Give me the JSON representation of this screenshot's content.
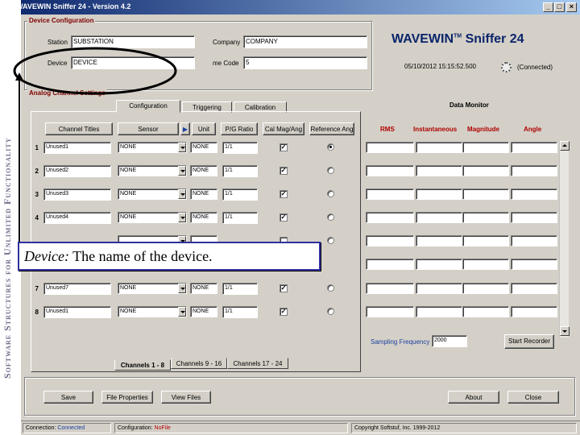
{
  "window": {
    "title": "WAVEWIN Sniffer 24 - Version 4.2",
    "minimize": "_",
    "maximize": "□",
    "close": "×"
  },
  "side_banner": "Software Structures for Unlimited Functionality",
  "device_config": {
    "group_label": "Device Configuration",
    "station_label": "Station",
    "station_value": "SUBSTATION",
    "company_label": "Company",
    "company_value": "COMPANY",
    "device_label": "Device",
    "device_value": "DEVICE",
    "timecode_label": "me Code",
    "timecode_value": "5"
  },
  "brand": {
    "name": "WAVEWIN",
    "tm": "TM",
    "product": "Sniffer 24",
    "datetime": "05/10/2012 15:15:52.500",
    "connected": "(Connected)"
  },
  "analog": {
    "group_label": "Analog Channel Settings",
    "tabs": [
      "Configuration",
      "Triggering",
      "Calibration"
    ],
    "headers": {
      "title": "Channel Titles",
      "sensor": "Sensor",
      "unit": "Unit",
      "pg_ratio": "P/G Ratio",
      "cal_mag": "Cal Mag/Ang",
      "ref_ang": "Reference Ang"
    },
    "rows": [
      {
        "num": "1",
        "title": "Unused1",
        "sensor": "NONE",
        "unit": "NONE",
        "ratio": "1/1",
        "cal": "✓",
        "ref": true
      },
      {
        "num": "2",
        "title": "Unused2",
        "sensor": "NONE",
        "unit": "NONE",
        "ratio": "1/1",
        "cal": "✓",
        "ref": false
      },
      {
        "num": "3",
        "title": "Unused3",
        "sensor": "NONE",
        "unit": "NONE",
        "ratio": "1/1",
        "cal": "✓",
        "ref": false
      },
      {
        "num": "4",
        "title": "Unused4",
        "sensor": "NONE",
        "unit": "NONE",
        "ratio": "1/1",
        "cal": "✓",
        "ref": false
      },
      {
        "num": "7",
        "title": "Unused7",
        "sensor": "NONE",
        "unit": "NONE",
        "ratio": "1/1",
        "cal": "✓",
        "ref": false
      },
      {
        "num": "8",
        "title": "Unused1",
        "sensor": "NONE",
        "unit": "NONE",
        "ratio": "1/1",
        "cal": "✓",
        "ref": false
      }
    ],
    "bottom_tabs": [
      "Channels 1 - 8",
      "Channels 9 - 16",
      "Channels 17 - 24"
    ]
  },
  "data_monitor": {
    "label": "Data Monitor",
    "headers": [
      "RMS",
      "Instantaneous",
      "Magnitude",
      "Angle"
    ],
    "sampling_label": "Sampling Frequency",
    "sampling_value": "2000",
    "start_button": "Start Recorder"
  },
  "footer_buttons": {
    "save": "Save",
    "file_properties": "File Properties",
    "view_files": "View Files",
    "about": "About",
    "close": "Close"
  },
  "status": {
    "connection_label": "Connection:",
    "connection_value": "Connected",
    "config_label": "Configuration:",
    "config_value": "NoFile",
    "copyright": "Copyright Softstuf, Inc. 1999-2012"
  },
  "tooltip": {
    "term": "Device:",
    "text": "The name of the device."
  },
  "colors": {
    "title_blue": "#0a246a",
    "label_red": "#b00000",
    "face": "#d4d0c8",
    "callout_border": "#3030a0"
  }
}
